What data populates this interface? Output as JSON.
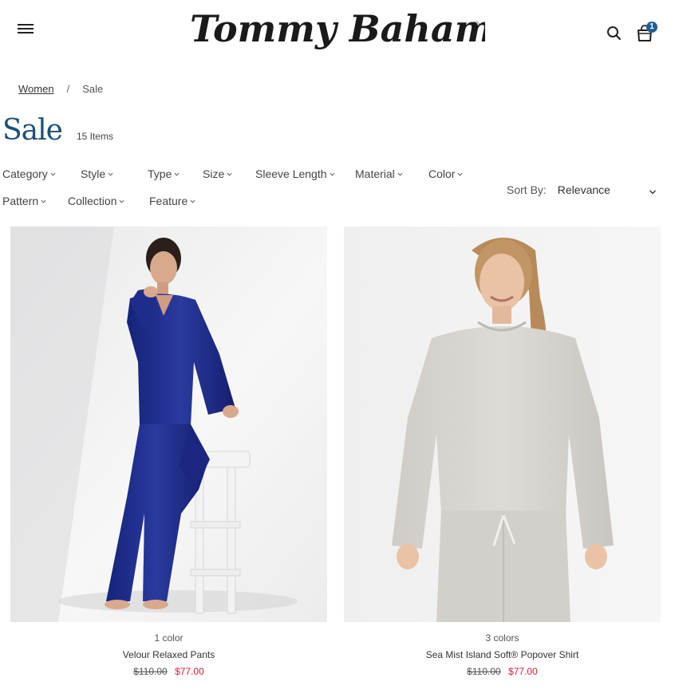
{
  "header": {
    "logo_text": "Tommy Bahama",
    "logo_mark": "®",
    "cart_count": "1",
    "icons": [
      "hamburger-menu-icon",
      "search-icon",
      "shopping-bag-icon"
    ]
  },
  "breadcrumb": {
    "items": [
      "Women",
      "Sale"
    ],
    "separator": "/"
  },
  "page": {
    "title": "Sale",
    "item_count": "15 Items"
  },
  "filters": {
    "row1": [
      "Category",
      "Style",
      "Type",
      "Size",
      "Sleeve Length",
      "Material",
      "Color"
    ],
    "row2": [
      "Pattern",
      "Collection",
      "Feature"
    ]
  },
  "sort": {
    "label": "Sort By:",
    "value": "Relevance"
  },
  "products": [
    {
      "colors": "1 color",
      "name": "Velour Relaxed Pants",
      "original_price": "$110.00",
      "sale_price": "$77.00"
    },
    {
      "colors": "3 colors",
      "name": "Sea Mist Island Soft® Popover Shirt",
      "original_price": "$110.00",
      "sale_price": "$77.00"
    }
  ],
  "colors": {
    "title_blue": "#1d4f7a",
    "badge_blue": "#1f5f97",
    "sale_red": "#d21e3c",
    "velour_blue": "#1c2c8c",
    "heather_grey": "#d7d4cf"
  }
}
